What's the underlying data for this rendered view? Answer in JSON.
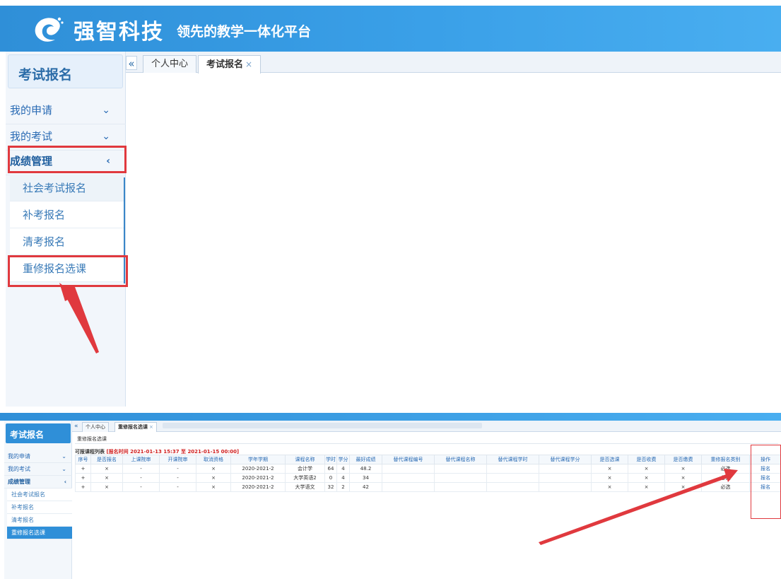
{
  "header": {
    "brand": "强智科技",
    "slogan": "领先的教学一体化平台",
    "colors": {
      "primary": "#2f8fd8",
      "highlight": "#e0393e"
    }
  },
  "top": {
    "sidebar": {
      "title": "考试报名",
      "items": [
        {
          "label": "我的申请",
          "icon": "chevron-down-icon"
        },
        {
          "label": "我的考试",
          "icon": "chevron-down-icon"
        },
        {
          "label": "成绩管理",
          "icon": "chevron-left-icon"
        }
      ],
      "subitems": [
        "社会考试报名",
        "补考报名",
        "清考报名",
        "重修报名选课"
      ]
    },
    "tabs": {
      "collapse": "«",
      "items": [
        {
          "label": "个人中心",
          "closable": false
        },
        {
          "label": "考试报名",
          "closable": true
        }
      ],
      "close": "×"
    }
  },
  "bottom": {
    "sidebar": {
      "title": "考试报名",
      "items": [
        {
          "label": "我的申请",
          "icon": "chevron-down-icon"
        },
        {
          "label": "我的考试",
          "icon": "chevron-down-icon"
        },
        {
          "label": "成绩管理",
          "icon": "chevron-left-icon"
        }
      ],
      "subitems": [
        "社会考试报名",
        "补考报名",
        "清考报名",
        "重修报名选课"
      ]
    },
    "tabs": {
      "collapse": "«",
      "items": [
        {
          "label": "个人中心"
        },
        {
          "label": "重修报名选课"
        }
      ],
      "close": "×"
    },
    "breadcrumb": "重修报名选课",
    "list_label": "可报课程列表",
    "list_time": "[报名时间 2021-01-13 15:37 至 2021-01-15 00:00]",
    "table": {
      "columns": [
        "序号",
        "是否报名",
        "上课院审",
        "开课院审",
        "取消资格",
        "学年学期",
        "课程名称",
        "学时",
        "学分",
        "最好成绩",
        "替代课程编号",
        "替代课程名称",
        "替代课程学时",
        "替代课程学分",
        "是否选课",
        "是否收费",
        "是否缴费",
        "重修报名类别",
        "操作"
      ],
      "rows": [
        [
          "+",
          "×",
          "-",
          "-",
          "×",
          "2020-2021-2",
          "会计学",
          "64",
          "4",
          "48.2",
          "",
          "",
          "",
          "",
          "×",
          "×",
          "×",
          "必选",
          "报名"
        ],
        [
          "+",
          "×",
          "-",
          "-",
          "×",
          "2020-2021-2",
          "大学英语2",
          "0",
          "4",
          "34",
          "",
          "",
          "",
          "",
          "×",
          "×",
          "×",
          "必选",
          "报名"
        ],
        [
          "+",
          "×",
          "-",
          "-",
          "×",
          "2020-2021-2",
          "大学语文",
          "32",
          "2",
          "42",
          "",
          "",
          "",
          "",
          "×",
          "×",
          "×",
          "必选",
          "报名"
        ]
      ]
    }
  }
}
